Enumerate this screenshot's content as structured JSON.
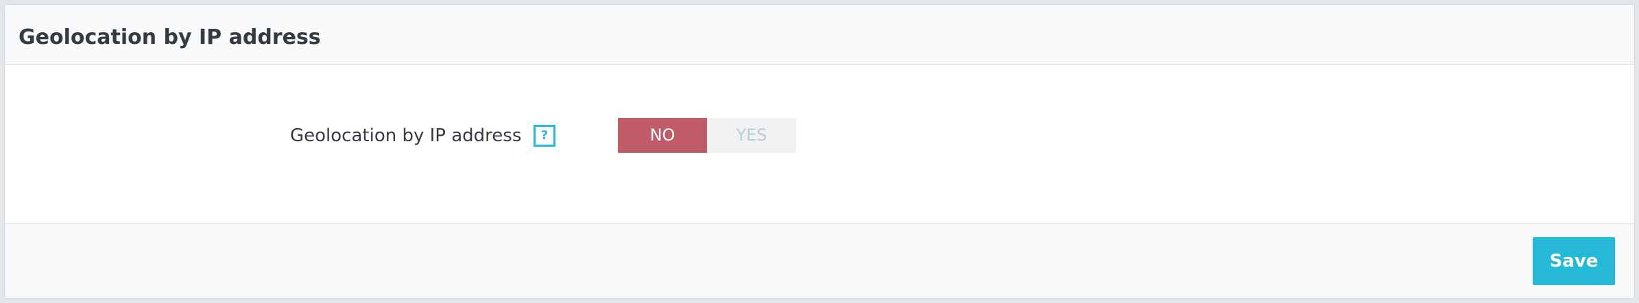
{
  "panel": {
    "title": "Geolocation by IP address"
  },
  "form": {
    "label": "Geolocation by IP address",
    "help_icon_glyph": "?",
    "help_icon": "help-question-icon",
    "switch": {
      "no_label": "NO",
      "yes_label": "YES",
      "selected": "NO"
    }
  },
  "footer": {
    "save_label": "Save"
  },
  "colors": {
    "accent": "#25b9d7",
    "switch_no_active": "#c05c67",
    "switch_inactive_bg": "#eff1f2",
    "switch_inactive_text": "#b7ced4",
    "text": "#363a41"
  }
}
